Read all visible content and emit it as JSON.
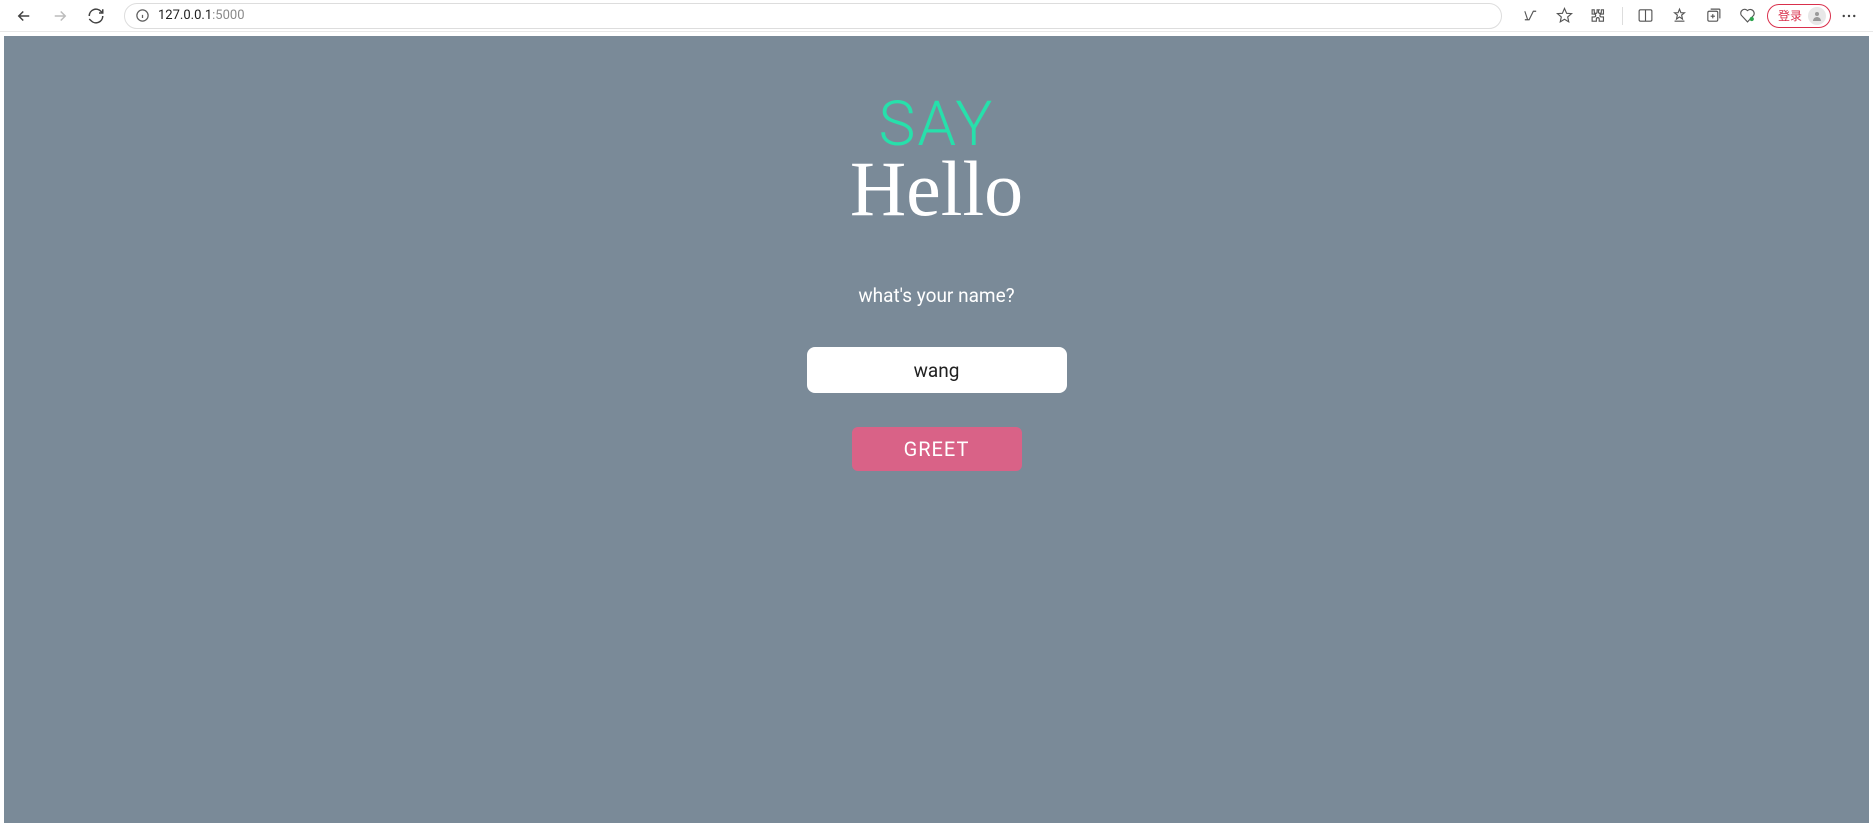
{
  "browser": {
    "url_host": "127.0.0.1",
    "url_port": ":5000",
    "login_label": "登录"
  },
  "page": {
    "logo_top": "SAY",
    "logo_bottom": "Hello",
    "prompt": "what's your name?",
    "name_value": "wang",
    "greet_label": "GREET"
  },
  "colors": {
    "page_bg": "#7a8a98",
    "accent_teal": "#27e0ab",
    "button_pink": "#d96287",
    "login_red": "#d9304c"
  }
}
